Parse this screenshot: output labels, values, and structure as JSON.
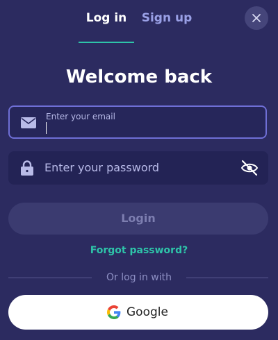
{
  "tabs": {
    "login": "Log in",
    "signup": "Sign up"
  },
  "title": "Welcome back",
  "email": {
    "label": "Enter your email",
    "value": ""
  },
  "password": {
    "placeholder": "Enter your password"
  },
  "login_button": "Login",
  "forgot_password": "Forgot password?",
  "divider_text": "Or log in with",
  "google_button": "Google",
  "icons": {
    "close": "close-icon",
    "email": "envelope-icon",
    "lock": "lock-icon",
    "visibility": "eye-off-icon",
    "google": "google-logo-icon"
  },
  "colors": {
    "background": "#2c2b60",
    "accent": "#2ec4a9",
    "field_border_focus": "#6f6fd6",
    "inactive_tab": "#9aa0e6"
  }
}
